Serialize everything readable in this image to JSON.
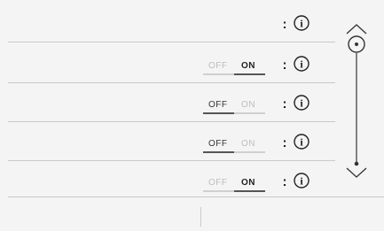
{
  "rows": [
    {
      "toggle": null,
      "more": ":",
      "info_icon": "info-circle-icon"
    },
    {
      "toggle": {
        "off_label": "OFF",
        "on_label": "ON",
        "state": "on"
      },
      "more": ":",
      "info_icon": "info-circle-icon"
    },
    {
      "toggle": {
        "off_label": "OFF",
        "on_label": "ON",
        "state": "off"
      },
      "more": ":",
      "info_icon": "info-circle-icon"
    },
    {
      "toggle": {
        "off_label": "OFF",
        "on_label": "ON",
        "state": "off"
      },
      "more": ":",
      "info_icon": "info-circle-icon"
    },
    {
      "toggle": {
        "off_label": "OFF",
        "on_label": "ON",
        "state": "on"
      },
      "more": ":",
      "info_icon": "info-circle-icon"
    }
  ],
  "scrollbar": {
    "up_icon": "chevron-up-icon",
    "down_icon": "chevron-down-icon",
    "thumb_icon": "target-circle-icon",
    "position": 0
  },
  "colors": {
    "background": "#f4f4f4",
    "separator": "#c9c9c9",
    "text_dark": "#1f1f1f",
    "text_dim": "#bdbdbd"
  }
}
